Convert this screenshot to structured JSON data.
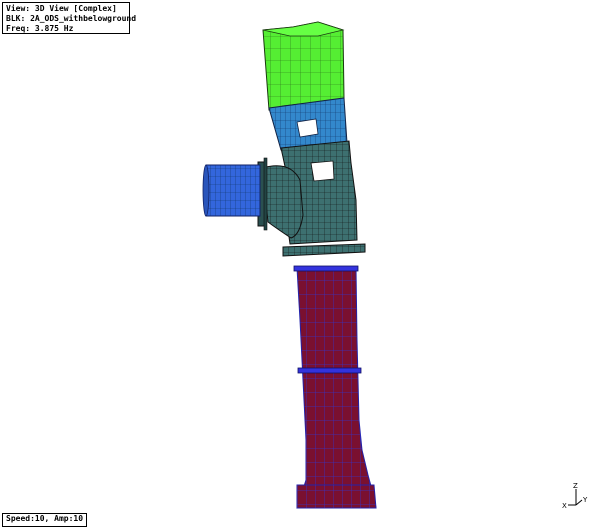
{
  "view": {
    "title": "View: 3D View [Complex]",
    "block": "BLK: 2A_ODS_withbelowground",
    "frequency": "Freq: 3.875 Hz"
  },
  "status": {
    "animation": "Speed:10, Amp:10"
  },
  "axes": {
    "z_label": "Z",
    "x_label": "X",
    "y_label": "Y"
  },
  "colors": {
    "motor": "#55ee33",
    "upper_head": "#3388cc",
    "discharge_head": "#336666",
    "discharge_pipe": "#3366dd",
    "column": "#7a1030",
    "column_mesh": "#3333cc",
    "mesh_dark": "#1a1a1a"
  }
}
